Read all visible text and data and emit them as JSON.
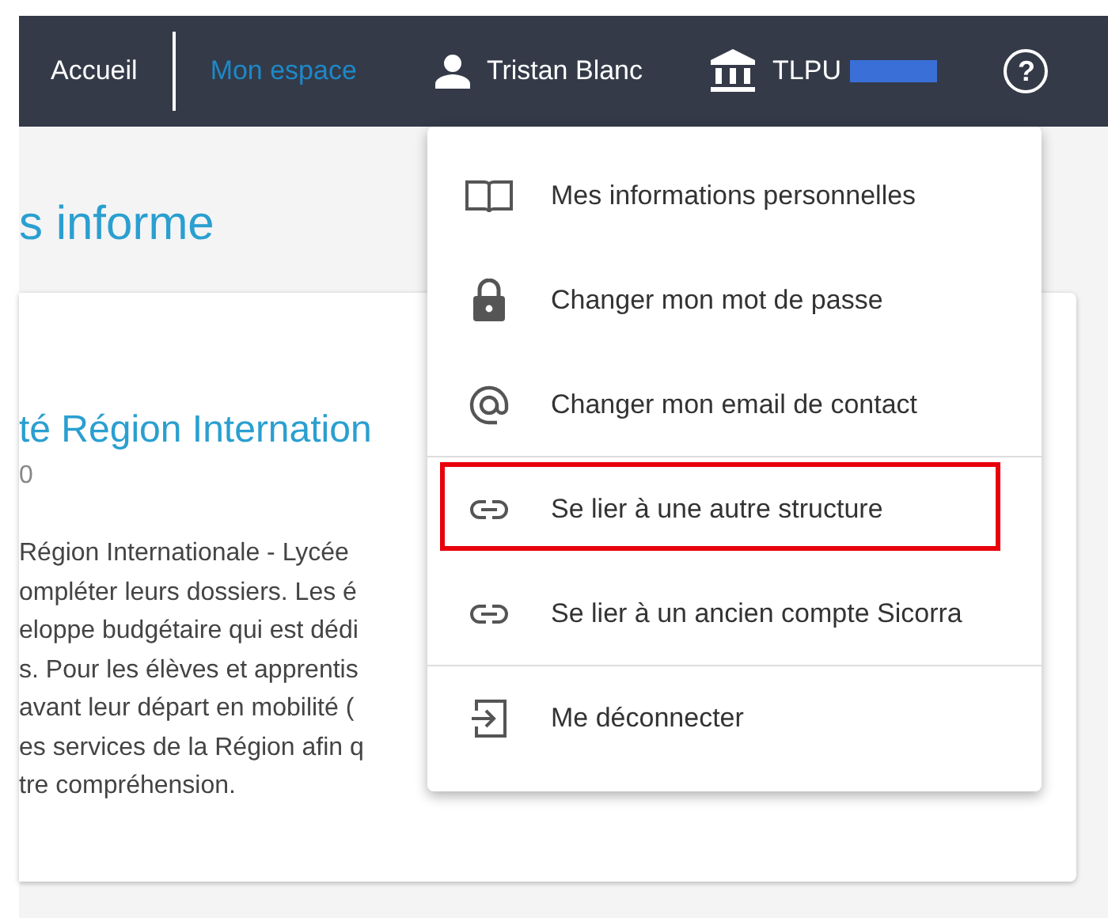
{
  "nav": {
    "links": [
      {
        "label": "Accueil",
        "selected": false
      },
      {
        "label": "Mon espace",
        "selected": true
      }
    ],
    "user": {
      "name": "Tristan Blanc"
    },
    "structure": {
      "code": "TLPU",
      "redacted": true
    },
    "help": {
      "label": "?"
    }
  },
  "page": {
    "heading": "s informe"
  },
  "card": {
    "title": "té Région Internation",
    "subtitle": "0",
    "lines": [
      "Région Internationale - Lycée",
      "ompléter leurs dossiers. Les é",
      "eloppe budgétaire qui est dédi",
      "s. Pour les élèves et apprentis",
      "avant leur départ en mobilité (",
      "es services de la Région afin q",
      "tre compréhension."
    ]
  },
  "menu": {
    "items": [
      {
        "label": "Mes informations personnelles",
        "kind": "book",
        "divider_after": false,
        "highlighted": false
      },
      {
        "label": "Changer mon mot de passe",
        "kind": "lock",
        "divider_after": false,
        "highlighted": false
      },
      {
        "label": "Changer mon email de contact",
        "kind": "at",
        "divider_after": true,
        "highlighted": false
      },
      {
        "label": "Se lier à une autre structure",
        "kind": "link",
        "divider_after": false,
        "highlighted": true
      },
      {
        "label": "Se lier à un ancien compte Sicorra",
        "kind": "link",
        "divider_after": true,
        "highlighted": false
      },
      {
        "label": "Me déconnecter",
        "kind": "logout",
        "divider_after": false,
        "highlighted": false
      }
    ]
  }
}
